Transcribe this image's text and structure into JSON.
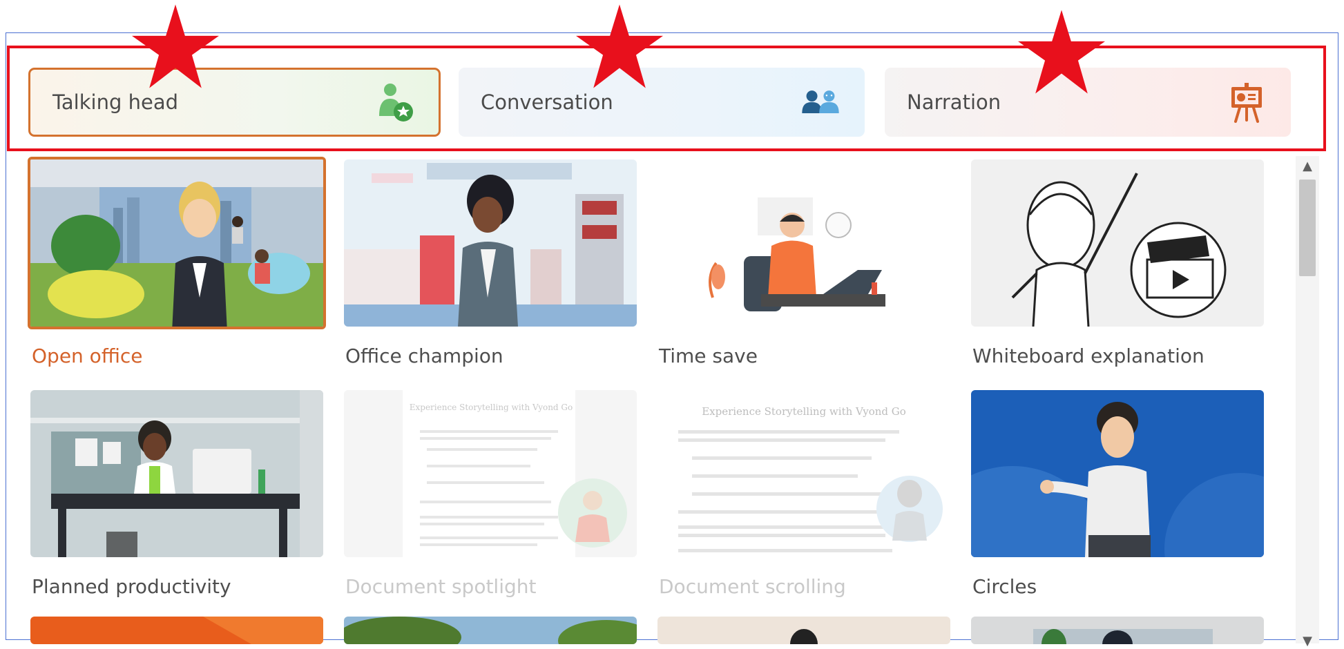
{
  "tabs": [
    {
      "label": "Talking head",
      "icon": "talking-head-icon",
      "selected": true
    },
    {
      "label": "Conversation",
      "icon": "conversation-icon",
      "selected": false
    },
    {
      "label": "Narration",
      "icon": "presentation-easel-icon",
      "selected": false
    }
  ],
  "templates": [
    {
      "title": "Open office",
      "selected": true
    },
    {
      "title": "Office champion"
    },
    {
      "title": "Time save"
    },
    {
      "title": "Whiteboard explanation"
    },
    {
      "title": "Planned productivity"
    },
    {
      "title": "Document spotlight",
      "faded": true
    },
    {
      "title": "Document scrolling",
      "faded": true
    },
    {
      "title": "Circles"
    }
  ],
  "doc_preview": {
    "heading": "Experience Storytelling with Vyond Go"
  },
  "colors": {
    "accent": "#d4722e",
    "annotation_red": "#e8101c",
    "green_icon": "#5cb85c",
    "blue_icon": "#3a84b8",
    "narration_icon": "#d4622a"
  }
}
